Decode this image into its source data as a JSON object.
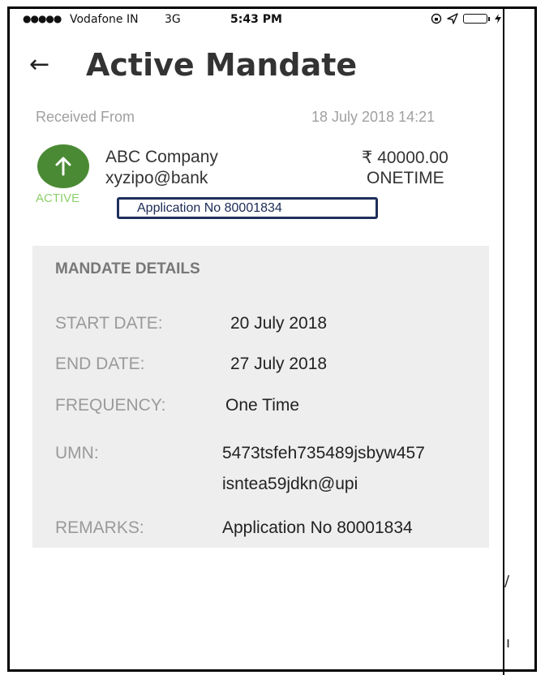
{
  "status_bar": {
    "signal": "●●●●●",
    "carrier": "Vodafone IN",
    "network": "3G",
    "time": "5:43 PM",
    "icons": [
      "lock-rotation-icon",
      "location-arrow-icon",
      "battery-icon"
    ],
    "battery_color": "#2ecc40"
  },
  "header": {
    "back_icon": "←",
    "title": "Active Mandate"
  },
  "received": {
    "label": "Received From",
    "datetime": "18 July 2018 14:21"
  },
  "payee": {
    "avatar_icon": "↑",
    "avatar_color": "#4b8a34",
    "status": "ACTIVE",
    "status_color": "#8dd06c",
    "name": "ABC Company",
    "vpa": "xyzipo@bank",
    "amount": "₹ 40000.00",
    "frequency": "ONETIME",
    "application_no": "Application No 80001834"
  },
  "mandate_details": {
    "heading": "MANDATE DETAILS",
    "start_date_label": "START DATE:",
    "start_date": "20 July 2018",
    "end_date_label": "END DATE:",
    "end_date": "27 July 2018",
    "frequency_label": "FREQUENCY:",
    "frequency": "One Time",
    "umn_label": "UMN:",
    "umn_line1": "5473tsfeh735489jsbyw457",
    "umn_line2": "isntea59jdkn@upi",
    "remarks_label": "REMARKS:",
    "remarks": "Application No 80001834"
  },
  "stray_marks": [
    "/",
    "ı"
  ]
}
